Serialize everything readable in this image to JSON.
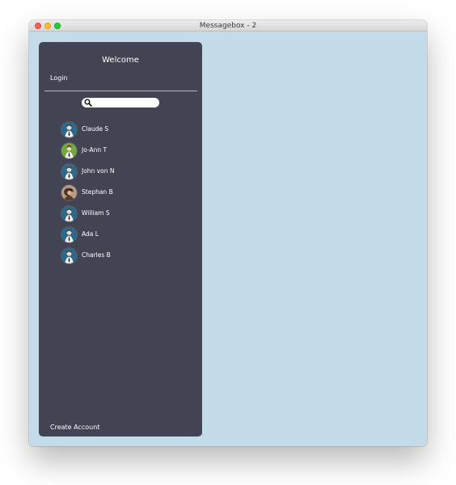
{
  "window": {
    "title": "Messagebox - 2"
  },
  "sidebar": {
    "welcome": "Welcome",
    "login": "Login",
    "search": {
      "value": "",
      "placeholder": ""
    },
    "contacts": [
      {
        "name": "Claude S",
        "avatar": "default-avatar"
      },
      {
        "name": "Jo-Ann T",
        "avatar": "green-avatar"
      },
      {
        "name": "John von N",
        "avatar": "default-avatar"
      },
      {
        "name": "Stephan B",
        "avatar": "photo-avatar"
      },
      {
        "name": "William S",
        "avatar": "default-avatar"
      },
      {
        "name": "Ada L",
        "avatar": "default-avatar"
      },
      {
        "name": "Charles B",
        "avatar": "default-avatar"
      }
    ],
    "create_account": "Create Account"
  },
  "colors": {
    "window_background": "#c4dbe9",
    "sidebar_background": "#434453",
    "divider": "#b7b7c3",
    "text": "#ffffff",
    "close": "#fe5f57",
    "minimize": "#febc2e",
    "zoom": "#28c840"
  },
  "icons": {
    "search": "search-icon",
    "default_avatar": "person-avatar-icon",
    "green_avatar": "green-person-avatar-icon",
    "photo_avatar": "photo-avatar-icon"
  }
}
